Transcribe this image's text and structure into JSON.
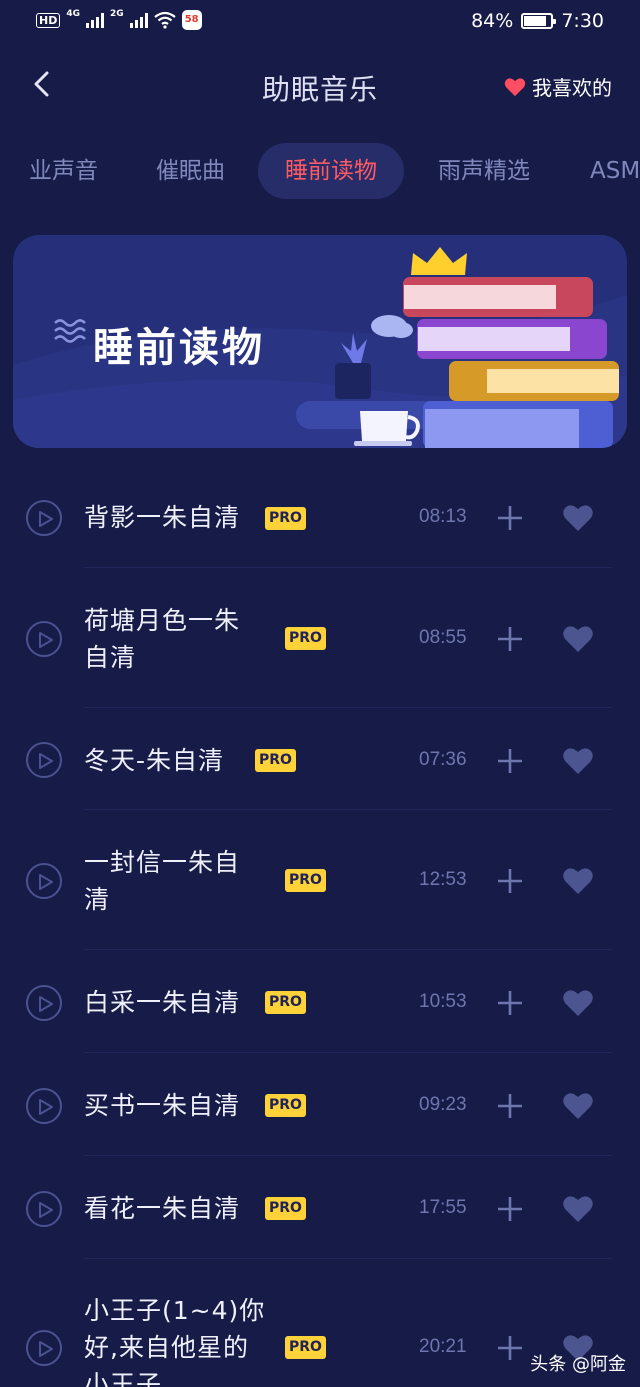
{
  "status_bar": {
    "hd": "HD",
    "net1": "4G",
    "net2": "2G",
    "app_badge": "58",
    "battery": "84%",
    "battery_level": 0.84,
    "time": "7:30"
  },
  "header": {
    "title": "助眠音乐",
    "favorites_label": "我喜欢的"
  },
  "tabs": [
    {
      "label": "业声音",
      "active": false
    },
    {
      "label": "催眠曲",
      "active": false
    },
    {
      "label": "睡前读物",
      "active": true
    },
    {
      "label": "雨声精选",
      "active": false
    },
    {
      "label": "ASM",
      "active": false
    }
  ],
  "banner": {
    "title": "睡前读物"
  },
  "badge_label": "PRO",
  "tracks": [
    {
      "line1": "背影一朱自清",
      "line2": "",
      "line3": "",
      "duration": "08:13"
    },
    {
      "line1": "荷塘月色一朱",
      "line2": "自清",
      "line3": "",
      "duration": "08:55"
    },
    {
      "line1": "冬天-朱自清",
      "line2": "",
      "line3": "",
      "duration": "07:36"
    },
    {
      "line1": "一封信一朱自",
      "line2": "清",
      "line3": "",
      "duration": "12:53"
    },
    {
      "line1": "白采一朱自清",
      "line2": "",
      "line3": "",
      "duration": "10:53"
    },
    {
      "line1": "买书一朱自清",
      "line2": "",
      "line3": "",
      "duration": "09:23"
    },
    {
      "line1": "看花一朱自清",
      "line2": "",
      "line3": "",
      "duration": "17:55"
    },
    {
      "line1": "小王子(1~4)你",
      "line2": "好,来自他星的",
      "line3": "小王子",
      "duration": "20:21"
    }
  ],
  "watermark": "头条 @阿金",
  "colors": {
    "background": "#161b47",
    "accent": "#ff5a64",
    "pro_badge": "#ffd23a",
    "banner": "#26307a"
  }
}
